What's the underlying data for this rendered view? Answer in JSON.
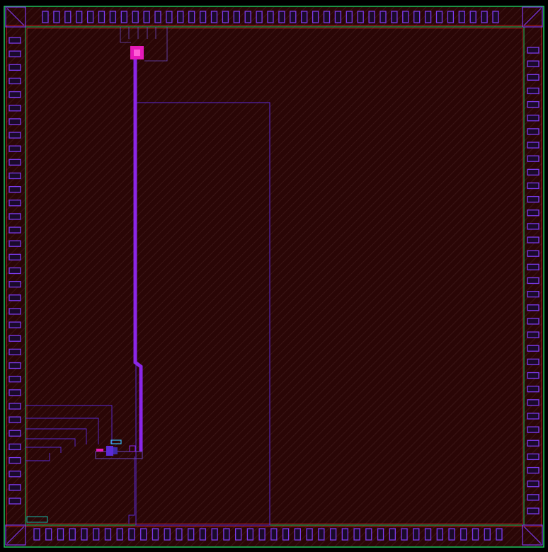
{
  "view": "chip-layout",
  "colors": {
    "background": "#000000",
    "die_fill": "#2a0606",
    "hatch": "#3a3a3a",
    "boundary": "#22c55e",
    "pad_outline": "#7c3aed",
    "pad_ring": "#dc2626",
    "metal_route": "#8b26e8",
    "wire": "#5b2ad6",
    "contact": "#e619b8",
    "cell_outline": "#6b46c1",
    "highlight": "#38bdf8"
  },
  "pads": {
    "top_count": 41,
    "bottom_count": 40,
    "left_count": 35,
    "right_count": 35
  }
}
